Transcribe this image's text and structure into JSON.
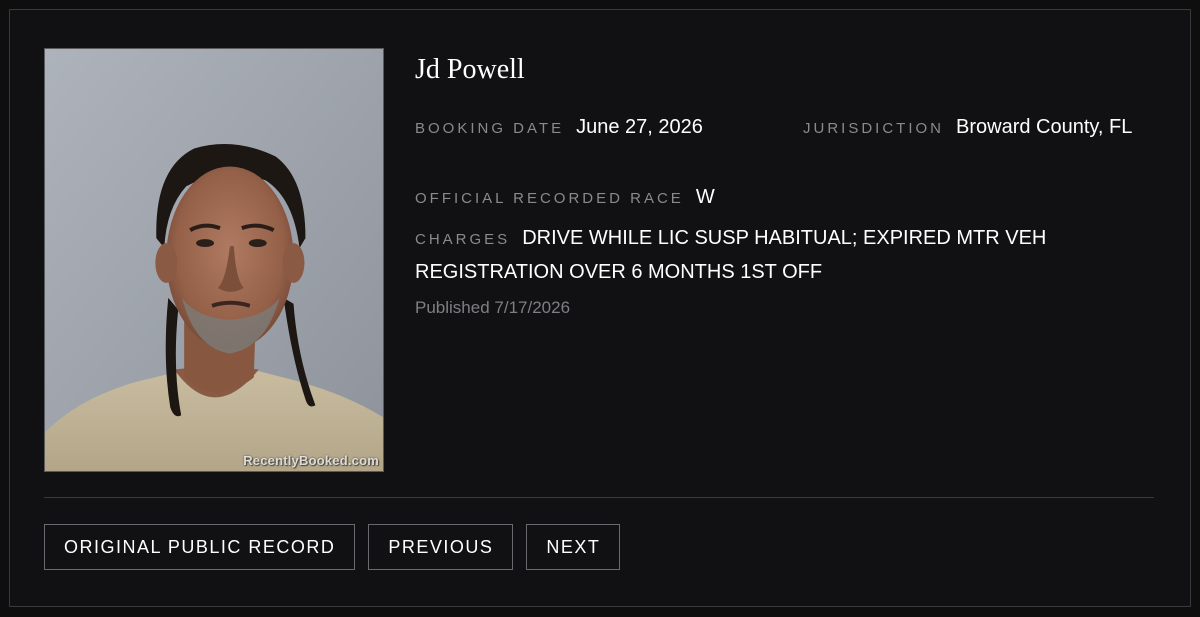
{
  "person": {
    "name": "Jd Powell",
    "photo_watermark": "RecentlyBooked.com"
  },
  "details": {
    "booking_date_label": "BOOKING DATE",
    "booking_date": "June 27, 2026",
    "jurisdiction_label": "JURISDICTION",
    "jurisdiction": "Broward County, FL",
    "race_label": "OFFICIAL RECORDED RACE",
    "race": "W",
    "charges_label": "CHARGES",
    "charges": "DRIVE WHILE LIC SUSP HABITUAL; EXPIRED MTR VEH REGISTRATION OVER 6 MONTHS 1ST OFF",
    "published": "Published 7/17/2026"
  },
  "actions": {
    "original_record": "ORIGINAL PUBLIC RECORD",
    "previous": "PREVIOUS",
    "next": "NEXT"
  },
  "colors": {
    "background": "#0e0e0f",
    "card": "#111113",
    "label": "#8a8a8d",
    "text": "#ffffff",
    "border": "#3a3a3d"
  }
}
